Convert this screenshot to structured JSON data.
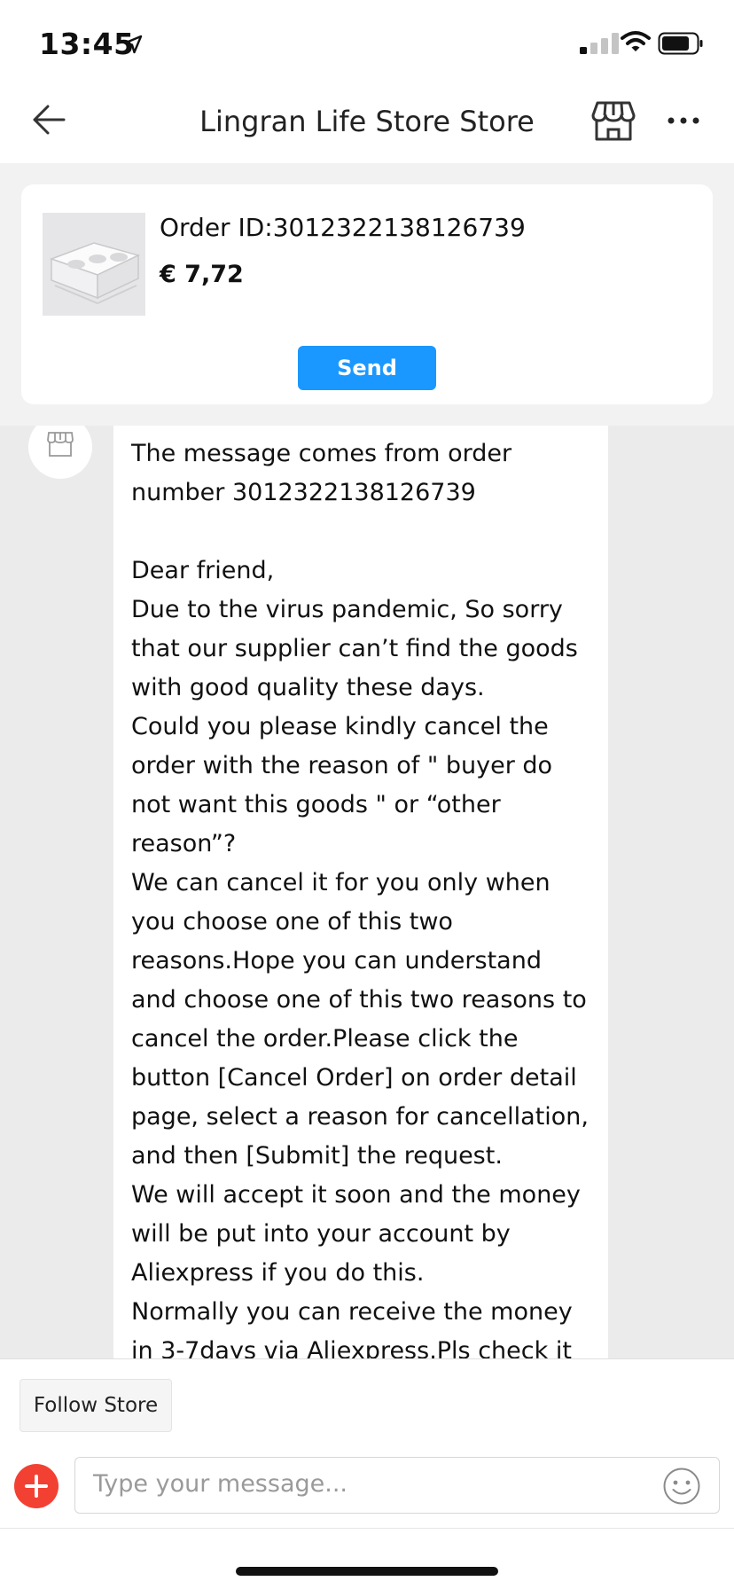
{
  "status_bar": {
    "time": "13:45"
  },
  "nav": {
    "title": "Lingran Life Store Store"
  },
  "order_card": {
    "order_id": "Order ID:3012322138126739",
    "price": "€ 7,72",
    "send_label": "Send"
  },
  "chat": {
    "message": "The message comes from order number 3012322138126739\n\nDear friend,\nDue to the virus pandemic, So sorry that our supplier can’t find the goods with good quality these days.\nCould you please kindly cancel the order with the reason of \" buyer do not want this goods \" or “other reason”?\nWe can cancel it for you only when you choose one of this two reasons.Hope you can understand and choose one of this two reasons to cancel the order.Please click the button [Cancel Order] on order detail page, select a reason for cancellation, and then [Submit] the request.\nWe will accept it soon and the money will be put into your account by Aliexpress if you do this.\nNormally you can receive the money in 3-7days via Aliexpress.Pls check it at that time."
  },
  "bottom": {
    "follow_label": "Follow Store",
    "input_placeholder": "Type your message..."
  },
  "colors": {
    "accent_blue": "#1a98ff",
    "plus_red": "#f24033",
    "chat_bg": "#ebebeb"
  },
  "icons": [
    "location-arrow-icon",
    "cell-signal-icon",
    "wifi-icon",
    "battery-icon",
    "back-arrow-icon",
    "store-icon",
    "more-icon",
    "plus-icon",
    "emoji-icon"
  ]
}
